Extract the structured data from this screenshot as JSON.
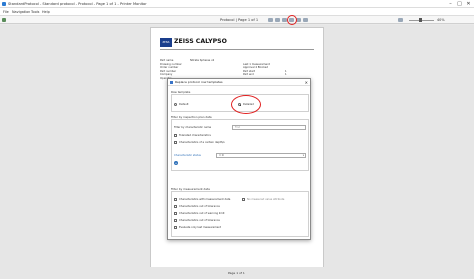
{
  "window": {
    "title": "StandardProtocol - Standard protocol - Protocol - Page 1 of 1 - Printer Monitor",
    "min": "–",
    "max": "□",
    "close": "✕"
  },
  "menu": {
    "file": "File",
    "navigation": "Navigation",
    "tools": "Tools",
    "help": "Help"
  },
  "toolbar": {
    "page_label": "Protocol  |  Page 1 of 1",
    "zoom": "40%"
  },
  "report": {
    "logo_text": "ZEISS",
    "brand": "ZEISS CALYPSO",
    "rows": [
      {
        "k": "Part name",
        "v": "Nitrate Spheres v2"
      },
      {
        "k": "Drawing number",
        "v": ""
      },
      {
        "k": "Order number",
        "v": ""
      },
      {
        "k": "Part number",
        "v": ""
      },
      {
        "k": "Company",
        "v": ""
      },
      {
        "k": "Operator",
        "v": ""
      }
    ],
    "rows_right": [
      {
        "k": "Last 1 measurement",
        "v": ""
      },
      {
        "k": "Approval 4 Blocked",
        "v": ""
      },
      {
        "k": "Part start",
        "v": "1"
      },
      {
        "k": "Part end",
        "v": "1"
      }
    ]
  },
  "dialog": {
    "title": "Replace protocol row templates",
    "close": "✕",
    "row_template": {
      "label": "Row template",
      "default": "Default",
      "detailed": "Detailed",
      "selected": "detailed"
    },
    "inspection_filter": {
      "label": "Filter by inspection plan data",
      "char_name_label": "Filter by characteristic name",
      "char_name_placeholder": "Find",
      "tolerated": "Tolerated characteristics",
      "depths": "Characteristics of a certain depth/s",
      "status_label": "Characteristic status",
      "status_value": "=   O",
      "add": "+"
    },
    "measurement_filter": {
      "label": "Filter by measurement data",
      "items": [
        "Characteristics with measurement data",
        "Characteristics out of tolerance",
        "Characteristics out of warning limit",
        "Characteristics out of tolerance",
        "Evaluate only last measurement"
      ],
      "no_data": "No measured value attribute"
    }
  },
  "status": {
    "page": "Page 1 of 1"
  },
  "colors": {
    "accent": "#2d6fb8",
    "annotation": "#e02020",
    "zeiss_blue": "#1a3e8c"
  }
}
